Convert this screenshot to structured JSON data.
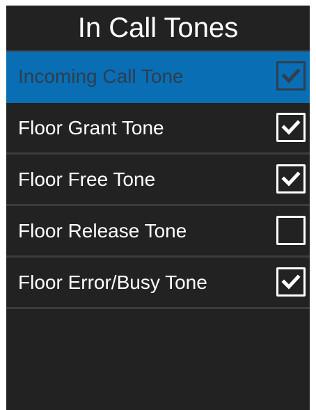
{
  "screen": {
    "title": "In Call Tones"
  },
  "tones": [
    {
      "label": "Incoming Call Tone",
      "checked": true,
      "selected": true
    },
    {
      "label": "Floor Grant Tone",
      "checked": true,
      "selected": false
    },
    {
      "label": "Floor Free Tone",
      "checked": true,
      "selected": false
    },
    {
      "label": "Floor Release Tone",
      "checked": false,
      "selected": false
    },
    {
      "label": "Floor Error/Busy Tone",
      "checked": true,
      "selected": false
    }
  ],
  "icons": {
    "checkbox_checked": "checkmark-icon"
  },
  "colors": {
    "background": "#222222",
    "selection": "#0a6eb4",
    "text": "#ffffff",
    "divider": "#3c3c3c"
  }
}
